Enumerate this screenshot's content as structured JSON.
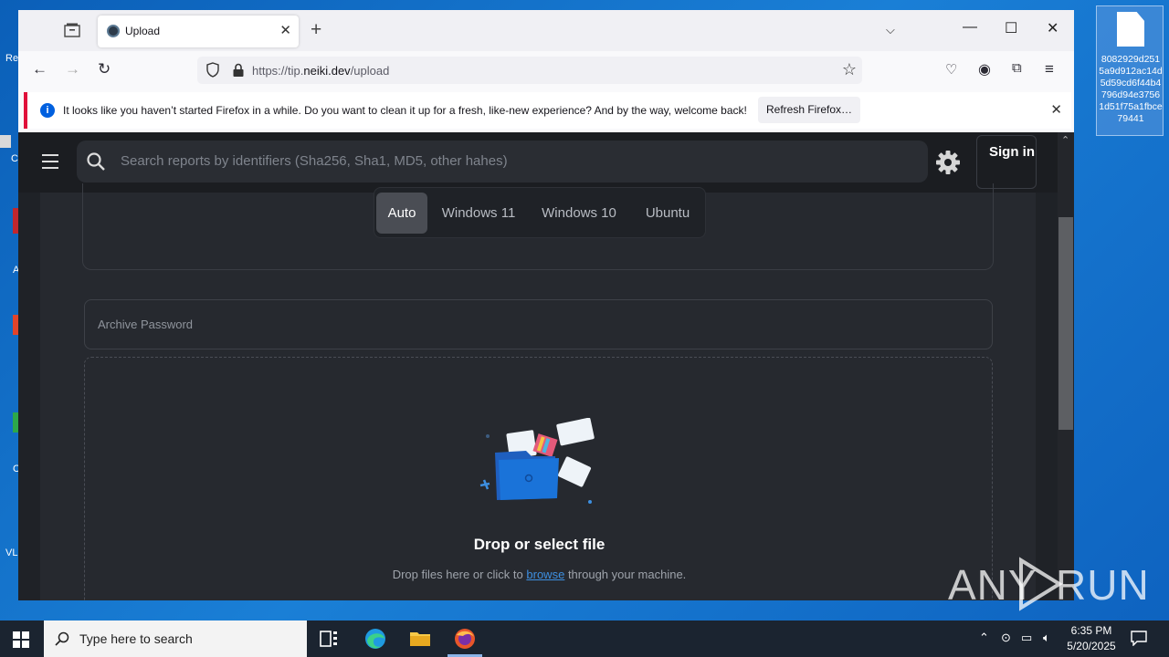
{
  "desktop": {
    "file_name": "8082929d2515a9d912ac14d5d59cd6f44b4796d94e37561d51f75a1fbce79441",
    "left_labels": [
      "Re",
      "C",
      "A",
      "C",
      "VL"
    ]
  },
  "browser": {
    "tab_title": "Upload",
    "url_host_prefix": "https://tip.",
    "url_host": "neiki.dev",
    "url_path": "/upload",
    "notification": {
      "message": "It looks like you haven’t started Firefox in a while. Do you want to clean it up for a fresh, like-new experience? And by the way, welcome back!",
      "button_label": "Refresh Firefox…"
    }
  },
  "page": {
    "search_placeholder": "Search reports by identifiers (Sha256, Sha1, MD5, other hahes)",
    "signin_label": "Sign in",
    "os_options": [
      "Auto",
      "Windows 11",
      "Windows 10",
      "Ubuntu"
    ],
    "os_selected": "Auto",
    "archive_password_placeholder": "Archive Password",
    "drop_title": "Drop or select file",
    "drop_sub_before": "Drop files here or click to",
    "drop_sub_link": "browse",
    "drop_sub_after": "through your machine."
  },
  "taskbar": {
    "search_placeholder": "Type here to search",
    "time": "6:35 PM",
    "date": "5/20/2025"
  },
  "watermark": {
    "left": "ANY",
    "right": "RUN"
  },
  "colors": {
    "accent": "#3d8fe0",
    "page_bg": "#1f2227",
    "notif_border": "#e0103a"
  }
}
